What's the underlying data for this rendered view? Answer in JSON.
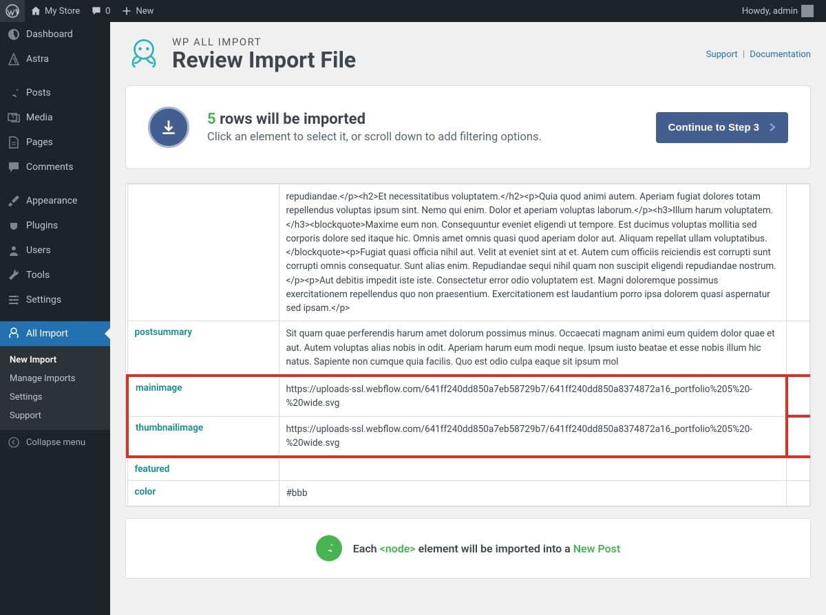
{
  "topbar": {
    "site_name": "My Store",
    "comments": "0",
    "new": "New",
    "howdy": "Howdy, admin"
  },
  "sidebar": {
    "dashboard": "Dashboard",
    "astra": "Astra",
    "posts": "Posts",
    "media": "Media",
    "pages": "Pages",
    "comments": "Comments",
    "appearance": "Appearance",
    "plugins": "Plugins",
    "users": "Users",
    "tools": "Tools",
    "settings": "Settings",
    "all_import": "All Import",
    "sub_new_import": "New Import",
    "sub_manage": "Manage Imports",
    "sub_settings": "Settings",
    "sub_support": "Support",
    "collapse": "Collapse menu"
  },
  "header": {
    "pretitle": "WP ALL IMPORT",
    "title": "Review Import File",
    "support": "Support",
    "docs": "Documentation"
  },
  "import_box": {
    "count": "5",
    "title_rest": "rows will be imported",
    "sub": "Click an element to select it, or scroll down to add filtering options.",
    "continue": "Continue to Step 3"
  },
  "table": {
    "postbody_key": "",
    "postbody_val": "repudiandae.</p><h2>Et necessitatibus voluptatem.</h2><p>Quia quod animi autem. Aperiam fugiat dolores totam repellendus voluptas ipsum sint. Nemo qui enim. Dolor et aperiam voluptas laborum.</p><h3>Illum harum voluptatem.</h3><blockquote>Maxime eum non. Consequuntur eveniet eligendi ut tempore. Est ducimus voluptas mollitia sed corporis dolore sed itaque hic. Omnis amet omnis quasi quod aperiam dolor aut. Aliquam repellat ullam voluptatibus.</blockquote><p>Fugiat quasi officia nihil aut. Velit at eveniet sint at et. Autem cum officiis reiciendis est corrupti sunt corrupti omnis consequatur. Sunt alias enim. Repudiandae sequi nihil quam non suscipit eligendi repudiandae nostrum.</p><p>Aut debitis impedit iste iste. Consectetur error odio voluptatem est. Magni doloremque possimus exercitationem repellendus quo non praesentium. Exercitationem est laudantium porro ipsa dolorem quasi aspernatur sed ipsam.</p>",
    "postsummary_key": "postsummary",
    "postsummary_val": "Sit quam quae perferendis harum amet dolorum possimus minus. Occaecati magnam animi eum quidem dolor quae et aut. Autem voluptas alias nobis in odit. Aperiam harum eum modi neque. Ipsum iusto beatae et esse nobis illum hic natus. Sapiente non cumque quia facilis. Quo est odio culpa eaque sit ipsum mol",
    "mainimage_key": "mainimage",
    "mainimage_val": "https://uploads-ssl.webflow.com/641ff240dd850a7eb58729b7/641ff240dd850a8374872a16_portfolio%205%20-%20wide.svg",
    "thumbnail_key": "thumbnailimage",
    "thumbnail_val": "https://uploads-ssl.webflow.com/641ff240dd850a7eb58729b7/641ff240dd850a8374872a16_portfolio%205%20-%20wide.svg",
    "featured_key": "featured",
    "featured_val": "",
    "color_key": "color",
    "color_val": "#bbb"
  },
  "footer": {
    "each": "Each",
    "node": "<node>",
    "middle": "element will be imported into a",
    "newpost": "New Post"
  }
}
